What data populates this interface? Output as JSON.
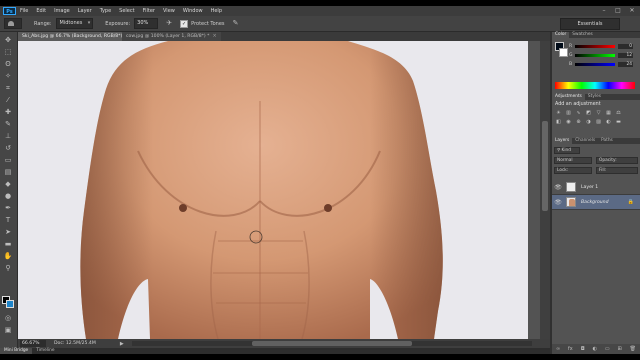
{
  "menu": {
    "app_logo": "Ps",
    "items": [
      "File",
      "Edit",
      "Image",
      "Layer",
      "Type",
      "Select",
      "Filter",
      "View",
      "Window",
      "Help"
    ]
  },
  "options": {
    "range_label": "Range:",
    "range_value": "Midtones",
    "exposure_label": "Exposure:",
    "exposure_value": "30%",
    "protect_tones_label": "Protect Tones",
    "workspace": "Essentials"
  },
  "tabs": [
    {
      "label": "Ski_Abs.jpg @ 66.7% (Background, RGB/8*) *",
      "active": true
    },
    {
      "label": "cow.jpg @ 100% (Layer 1, RGB/8*) *",
      "active": false
    }
  ],
  "status": {
    "zoom": "66.67%",
    "doc": "Doc: 12.5M/25.4M"
  },
  "bottom_tabs": [
    "Mini Bridge",
    "Timeline"
  ],
  "color_panel": {
    "tabs": [
      "Color",
      "Swatches"
    ],
    "r": "0",
    "g": "12",
    "b": "24",
    "accent": "#1e84c9"
  },
  "adjustments": {
    "tabs": [
      "Adjustments",
      "Styles"
    ],
    "title": "Add an adjustment"
  },
  "layers_panel": {
    "tabs": [
      "Layers",
      "Channels",
      "Paths"
    ],
    "kind": "Kind",
    "mode": "Normal",
    "opacity_label": "Opacity:",
    "lock_label": "Lock:",
    "fill_label": "Fill:",
    "layers": [
      {
        "name": "Layer 1",
        "selected": false
      },
      {
        "name": "Background",
        "selected": true
      }
    ]
  }
}
